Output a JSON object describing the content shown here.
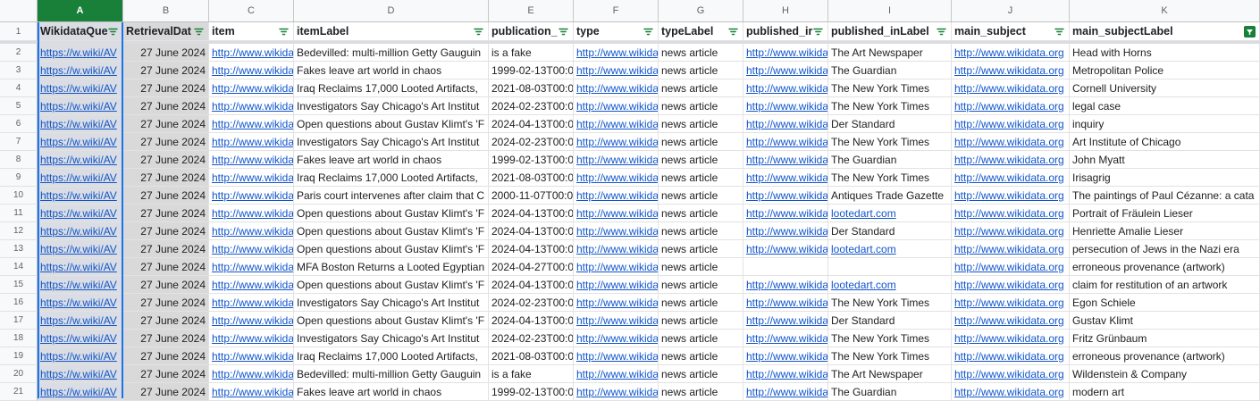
{
  "colors": {
    "selected_header": "#188038",
    "link": "#1155cc",
    "filter_active": "#188038"
  },
  "columns": [
    {
      "letter": "A",
      "header": "WikidataQue",
      "selected": true
    },
    {
      "letter": "B",
      "header": "RetrievalDat"
    },
    {
      "letter": "C",
      "header": "item"
    },
    {
      "letter": "D",
      "header": "itemLabel"
    },
    {
      "letter": "E",
      "header": "publication_"
    },
    {
      "letter": "F",
      "header": "type"
    },
    {
      "letter": "G",
      "header": "typeLabel"
    },
    {
      "letter": "H",
      "header": "published_ir"
    },
    {
      "letter": "I",
      "header": "published_inLabel"
    },
    {
      "letter": "J",
      "header": "main_subject"
    },
    {
      "letter": "K",
      "header": "main_subjectLabel",
      "filter_active": true
    }
  ],
  "header_row_number": "1",
  "rows": [
    {
      "n": "2",
      "a": "https://w.wiki/AV",
      "b": "27 June 2024",
      "c": "http://www.wikida",
      "d": "Bedevilled: multi-million Getty Gauguin",
      "e": "is a fake",
      "f": "http://www.wikida",
      "g": "news article",
      "h": "http://www.wikida",
      "i": "The Art Newspaper",
      "j": "http://www.wikidata.org",
      "k": "Head with Horns"
    },
    {
      "n": "3",
      "a": "https://w.wiki/AV",
      "b": "27 June 2024",
      "c": "http://www.wikida",
      "d": "Fakes leave art world in chaos",
      "e": "1999-02-13T00:0",
      "f": "http://www.wikida",
      "g": "news article",
      "h": "http://www.wikida",
      "i": "The Guardian",
      "j": "http://www.wikidata.org",
      "k": "Metropolitan Police"
    },
    {
      "n": "4",
      "a": "https://w.wiki/AV",
      "b": "27 June 2024",
      "c": "http://www.wikida",
      "d": "Iraq Reclaims 17,000 Looted Artifacts,",
      "e": "2021-08-03T00:0",
      "f": "http://www.wikida",
      "g": "news article",
      "h": "http://www.wikida",
      "i": "The New York Times",
      "j": "http://www.wikidata.org",
      "k": "Cornell University"
    },
    {
      "n": "5",
      "a": "https://w.wiki/AV",
      "b": "27 June 2024",
      "c": "http://www.wikida",
      "d": "Investigators Say Chicago's Art Institut",
      "e": "2024-02-23T00:0",
      "f": "http://www.wikida",
      "g": "news article",
      "h": "http://www.wikida",
      "i": "The New York Times",
      "j": "http://www.wikidata.org",
      "k": "legal case"
    },
    {
      "n": "6",
      "a": "https://w.wiki/AV",
      "b": "27 June 2024",
      "c": "http://www.wikida",
      "d": "Open questions about Gustav Klimt's 'F",
      "e": "2024-04-13T00:0",
      "f": "http://www.wikida",
      "g": "news article",
      "h": "http://www.wikida",
      "i": "Der Standard",
      "j": "http://www.wikidata.org",
      "k": "inquiry"
    },
    {
      "n": "7",
      "a": "https://w.wiki/AV",
      "b": "27 June 2024",
      "c": "http://www.wikida",
      "d": "Investigators Say Chicago's Art Institut",
      "e": "2024-02-23T00:0",
      "f": "http://www.wikida",
      "g": "news article",
      "h": "http://www.wikida",
      "i": "The New York Times",
      "j": "http://www.wikidata.org",
      "k": "Art Institute of Chicago"
    },
    {
      "n": "8",
      "a": "https://w.wiki/AV",
      "b": "27 June 2024",
      "c": "http://www.wikida",
      "d": "Fakes leave art world in chaos",
      "e": "1999-02-13T00:0",
      "f": "http://www.wikida",
      "g": "news article",
      "h": "http://www.wikida",
      "i": "The Guardian",
      "j": "http://www.wikidata.org",
      "k": "John Myatt"
    },
    {
      "n": "9",
      "a": "https://w.wiki/AV",
      "b": "27 June 2024",
      "c": "http://www.wikida",
      "d": "Iraq Reclaims 17,000 Looted Artifacts,",
      "e": "2021-08-03T00:0",
      "f": "http://www.wikida",
      "g": "news article",
      "h": "http://www.wikida",
      "i": "The New York Times",
      "j": "http://www.wikidata.org",
      "k": "Irisagrig"
    },
    {
      "n": "10",
      "a": "https://w.wiki/AV",
      "b": "27 June 2024",
      "c": "http://www.wikida",
      "d": "Paris court intervenes after claim that C",
      "e": "2000-11-07T00:0",
      "f": "http://www.wikida",
      "g": "news article",
      "h": "http://www.wikida",
      "i": "Antiques Trade Gazette",
      "j": "http://www.wikidata.org",
      "k": "The paintings of Paul Cézanne: a cata"
    },
    {
      "n": "11",
      "a": "https://w.wiki/AV",
      "b": "27 June 2024",
      "c": "http://www.wikida",
      "d": "Open questions about Gustav Klimt's 'F",
      "e": "2024-04-13T00:0",
      "f": "http://www.wikida",
      "g": "news article",
      "h": "http://www.wikida",
      "i": "lootedart.com",
      "i_link": true,
      "j": "http://www.wikidata.org",
      "k": "Portrait of Fräulein Lieser"
    },
    {
      "n": "12",
      "a": "https://w.wiki/AV",
      "b": "27 June 2024",
      "c": "http://www.wikida",
      "d": "Open questions about Gustav Klimt's 'F",
      "e": "2024-04-13T00:0",
      "f": "http://www.wikida",
      "g": "news article",
      "h": "http://www.wikida",
      "i": "Der Standard",
      "j": "http://www.wikidata.org",
      "k": "Henriette Amalie Lieser"
    },
    {
      "n": "13",
      "a": "https://w.wiki/AV",
      "b": "27 June 2024",
      "c": "http://www.wikida",
      "d": "Open questions about Gustav Klimt's 'F",
      "e": "2024-04-13T00:0",
      "f": "http://www.wikida",
      "g": "news article",
      "h": "http://www.wikida",
      "i": "lootedart.com",
      "i_link": true,
      "j": "http://www.wikidata.org",
      "k": "persecution of Jews in the Nazi era"
    },
    {
      "n": "14",
      "a": "https://w.wiki/AV",
      "b": "27 June 2024",
      "c": "http://www.wikida",
      "d": "MFA Boston Returns a Looted Egyptian",
      "e": "2024-04-27T00:0",
      "f": "http://www.wikida",
      "g": "news article",
      "h": "",
      "i": "",
      "j": "http://www.wikidata.org",
      "k": "erroneous provenance (artwork)"
    },
    {
      "n": "15",
      "a": "https://w.wiki/AV",
      "b": "27 June 2024",
      "c": "http://www.wikida",
      "d": "Open questions about Gustav Klimt's 'F",
      "e": "2024-04-13T00:0",
      "f": "http://www.wikida",
      "g": "news article",
      "h": "http://www.wikida",
      "i": "lootedart.com",
      "i_link": true,
      "j": "http://www.wikidata.org",
      "k": "claim for restitution of an artwork"
    },
    {
      "n": "16",
      "a": "https://w.wiki/AV",
      "b": "27 June 2024",
      "c": "http://www.wikida",
      "d": "Investigators Say Chicago's Art Institut",
      "e": "2024-02-23T00:0",
      "f": "http://www.wikida",
      "g": "news article",
      "h": "http://www.wikida",
      "i": "The New York Times",
      "j": "http://www.wikidata.org",
      "k": "Egon Schiele"
    },
    {
      "n": "17",
      "a": "https://w.wiki/AV",
      "b": "27 June 2024",
      "c": "http://www.wikida",
      "d": "Open questions about Gustav Klimt's 'F",
      "e": "2024-04-13T00:0",
      "f": "http://www.wikida",
      "g": "news article",
      "h": "http://www.wikida",
      "i": "Der Standard",
      "j": "http://www.wikidata.org",
      "k": "Gustav Klimt"
    },
    {
      "n": "18",
      "a": "https://w.wiki/AV",
      "b": "27 June 2024",
      "c": "http://www.wikida",
      "d": "Investigators Say Chicago's Art Institut",
      "e": "2024-02-23T00:0",
      "f": "http://www.wikida",
      "g": "news article",
      "h": "http://www.wikida",
      "i": "The New York Times",
      "j": "http://www.wikidata.org",
      "k": "Fritz Grünbaum"
    },
    {
      "n": "19",
      "a": "https://w.wiki/AV",
      "b": "27 June 2024",
      "c": "http://www.wikida",
      "d": "Iraq Reclaims 17,000 Looted Artifacts,",
      "e": "2021-08-03T00:0",
      "f": "http://www.wikida",
      "g": "news article",
      "h": "http://www.wikida",
      "i": "The New York Times",
      "j": "http://www.wikidata.org",
      "k": "erroneous provenance (artwork)"
    },
    {
      "n": "20",
      "a": "https://w.wiki/AV",
      "b": "27 June 2024",
      "c": "http://www.wikida",
      "d": "Bedevilled: multi-million Getty Gauguin",
      "e": "is a fake",
      "f": "http://www.wikida",
      "g": "news article",
      "h": "http://www.wikida",
      "i": "The Art Newspaper",
      "j": "http://www.wikidata.org",
      "k": "Wildenstein & Company"
    },
    {
      "n": "21",
      "a": "https://w.wiki/AV",
      "b": "27 June 2024",
      "c": "http://www.wikida",
      "d": "Fakes leave art world in chaos",
      "e": "1999-02-13T00:0",
      "f": "http://www.wikida",
      "g": "news article",
      "h": "http://www.wikida",
      "i": "The Guardian",
      "j": "http://www.wikidata.org",
      "k": "modern art"
    }
  ]
}
